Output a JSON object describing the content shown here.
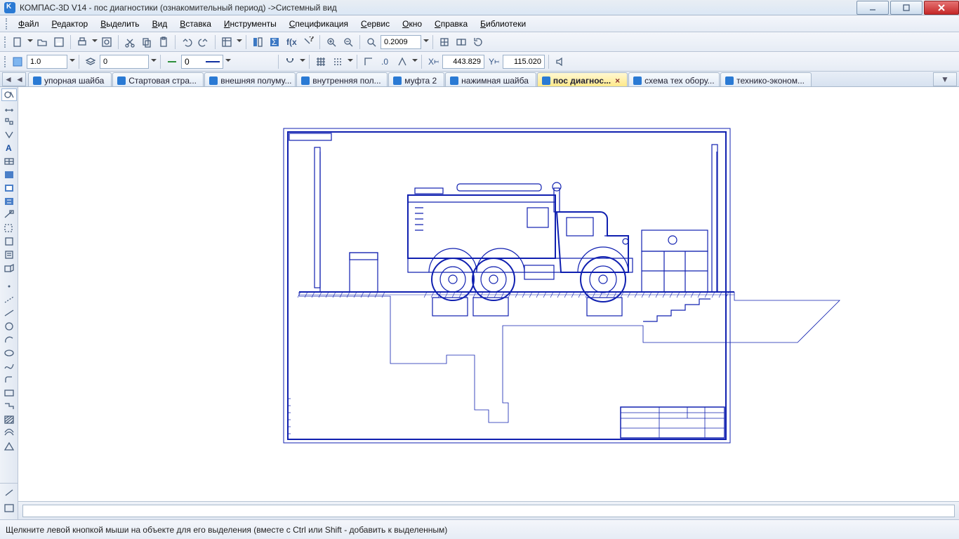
{
  "title": "КОМПАС-3D V14 - пос диагностики (ознакомительный период) ->Системный вид",
  "menu": [
    "Файл",
    "Редактор",
    "Выделить",
    "Вид",
    "Вставка",
    "Инструменты",
    "Спецификация",
    "Сервис",
    "Окно",
    "Справка",
    "Библиотеки"
  ],
  "toolbar1": {
    "zoom_value": "0.2009"
  },
  "toolbar2": {
    "scale": "1.0",
    "layer": "0",
    "style": "0",
    "coord_x": "443.829",
    "coord_y": "115.020"
  },
  "tabs": [
    {
      "label": "упорная шайба",
      "active": false
    },
    {
      "label": "Стартовая стра...",
      "active": false
    },
    {
      "label": "внешняя полуму...",
      "active": false
    },
    {
      "label": "внутренняя пол...",
      "active": false
    },
    {
      "label": "муфта 2",
      "active": false
    },
    {
      "label": "нажимная  шайба",
      "active": false
    },
    {
      "label": "пос диагнос...",
      "active": true,
      "closeable": true
    },
    {
      "label": "схема тех обору...",
      "active": false
    },
    {
      "label": "технико-эконом...",
      "active": false
    }
  ],
  "status": "Щелкните левой кнопкой мыши на объекте для его выделения (вместе с Ctrl или Shift - добавить к выделенным)"
}
